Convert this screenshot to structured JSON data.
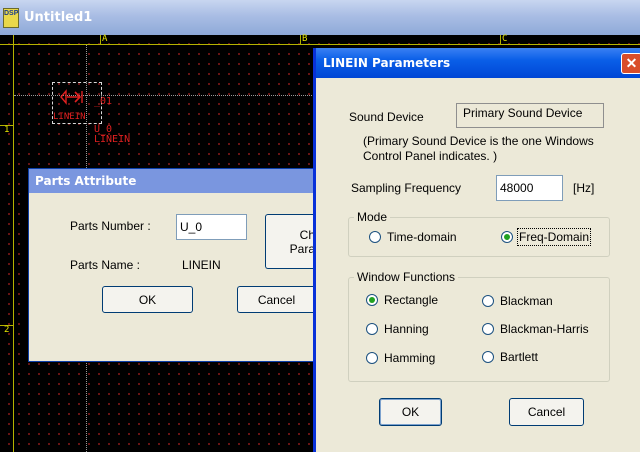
{
  "main_window": {
    "title": "Untitled1",
    "icon": "dsp-app-icon",
    "icon_text": "DSP"
  },
  "canvas": {
    "column_labels": [
      "A",
      "B",
      "C"
    ],
    "row_labels": [
      "1",
      "2"
    ],
    "part": {
      "symbol_icon": "speaker-arrow-icon",
      "pin_label": "_01",
      "type_label": "LINEIN",
      "instance_name": "U_0",
      "instance_type": "LINEIN"
    }
  },
  "parts_attribute": {
    "title": "Parts Attribute",
    "parts_number_label": "Parts Number :",
    "parts_number_value": "U_0",
    "parts_name_label": "Parts Name :",
    "parts_name_value": "LINEIN",
    "change_params_line1": "Ch",
    "change_params_line2": "Para",
    "ok_label": "OK",
    "cancel_label": "Cancel"
  },
  "linein": {
    "title": "LINEIN Parameters",
    "close_icon": "close-icon",
    "sound_device_label": "Sound Device",
    "sound_device_value": "Primary Sound Device",
    "note_line1": "(Primary Sound Device is the one Windows",
    "note_line2": "Control Panel indicates. )",
    "sampling_label": "Sampling Frequency",
    "sampling_value": "48000",
    "sampling_unit": "[Hz]",
    "mode": {
      "label": "Mode",
      "options": [
        "Time-domain",
        "Freq-Domain"
      ],
      "selected": "Freq-Domain"
    },
    "window_functions": {
      "label": "Window Functions",
      "options": [
        "Rectangle",
        "Blackman",
        "Hanning",
        "Blackman-Harris",
        "Hamming",
        "Bartlett"
      ],
      "selected": "Rectangle"
    },
    "ok_label": "OK",
    "cancel_label": "Cancel"
  },
  "colors": {
    "canvas_bg": "#000000",
    "grid_dot": "#7a1818",
    "ruler": "#e6e600",
    "part_red": "#e02020",
    "xp_title_blue": "#0a5fe8",
    "dialog_face": "#ece9d8"
  }
}
